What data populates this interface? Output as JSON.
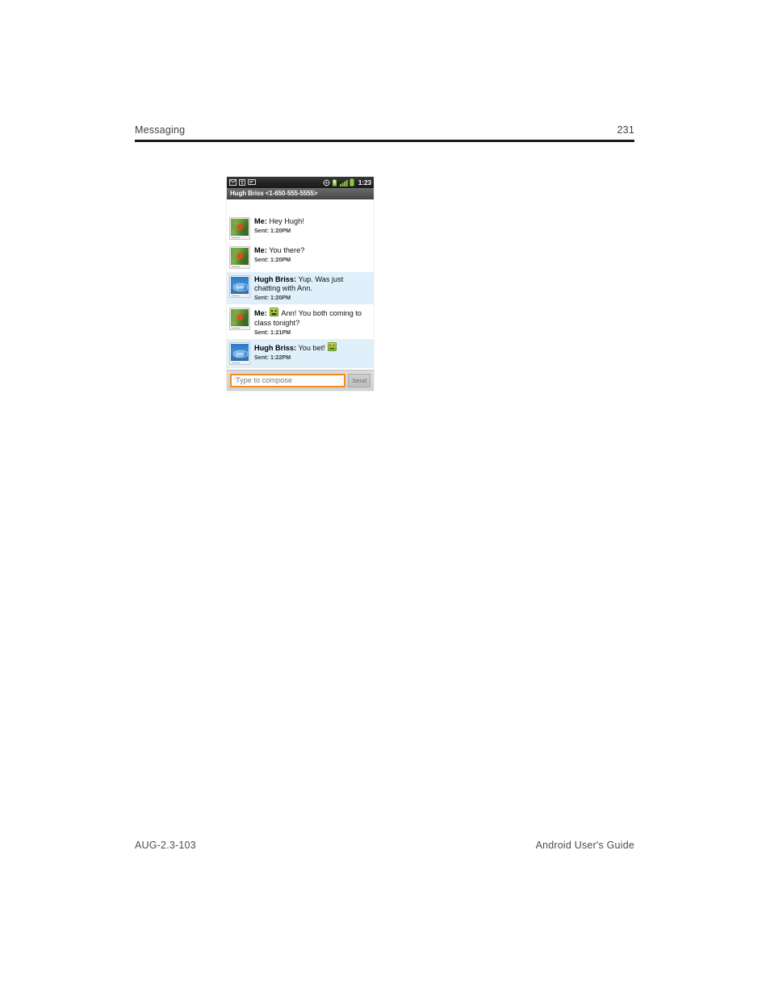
{
  "page": {
    "header_left": "Messaging",
    "header_right": "231",
    "footer_left": "AUG-2.3-103",
    "footer_right": "Android User's Guide"
  },
  "phone": {
    "status_bar": {
      "time": "1:23",
      "left_icons": [
        "email-icon",
        "text-input-icon",
        "sms-message-icon"
      ],
      "right_icons": [
        "gps-location-icon",
        "usb-debug-icon",
        "signal-bars-icon",
        "battery-icon"
      ]
    },
    "title_bar": {
      "title": "Hugh Briss <1-650-555-5555>"
    },
    "messages": [
      {
        "sender": "Me:",
        "text": " Hey Hugh!",
        "time": "Sent: 1:20PM",
        "direction": "outgoing",
        "avatar": "flower-photo-avatar",
        "emoji_before": false
      },
      {
        "sender": "Me:",
        "text": " You there?",
        "time": "Sent: 1:20PM",
        "direction": "outgoing",
        "avatar": "flower-photo-avatar",
        "emoji_before": false
      },
      {
        "sender": "Hugh Briss:",
        "text": " Yup. Was just chatting with Ann.",
        "time": "Sent: 1:20PM",
        "direction": "incoming",
        "avatar": "bicycle-photo-avatar",
        "emoji_before": false
      },
      {
        "sender": "Me:",
        "text": " Ann! You both coming to class tonight?",
        "time": "Sent: 1:21PM",
        "direction": "outgoing",
        "avatar": "flower-photo-avatar",
        "emoji_before": true
      },
      {
        "sender": "Hugh Briss:",
        "text": " You bet!",
        "time": "Sent: 1:22PM",
        "direction": "incoming",
        "avatar": "bicycle-photo-avatar",
        "emoji_after": true
      }
    ],
    "compose": {
      "placeholder": "Type to compose",
      "value": "",
      "send_label": "Send"
    },
    "colors": {
      "incoming_bubble": "#dff0fb",
      "outgoing_bubble": "#ffffff",
      "input_focus_border": "#f58a1f",
      "status_bar": "#1a1a1a",
      "title_bar": "#585858"
    }
  }
}
